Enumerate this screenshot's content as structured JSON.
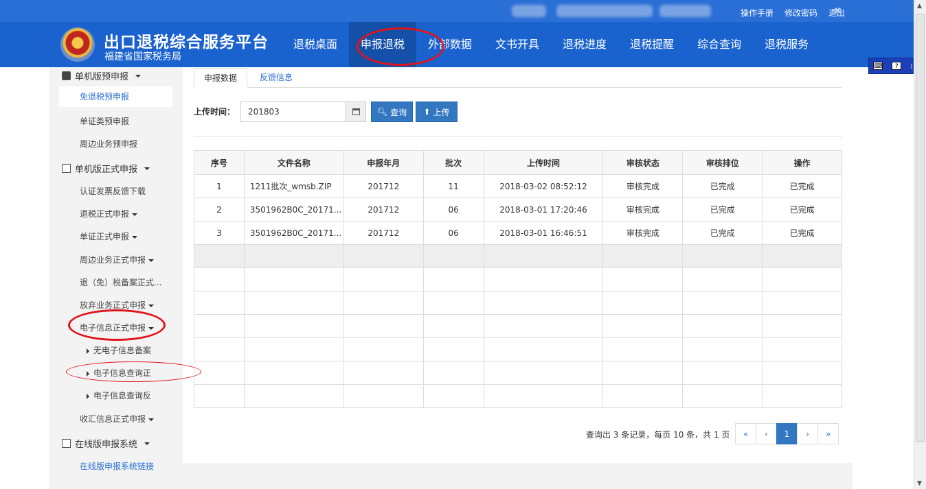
{
  "topbar": {
    "links": [
      "操作手册",
      "修改密码",
      "退出"
    ],
    "close_icon": "✖"
  },
  "header": {
    "title": "出口退税综合服务平台",
    "subtitle": "福建省国家税务局",
    "nav": [
      "退税桌面",
      "申报退税",
      "外部数据",
      "文书开具",
      "退税进度",
      "退税提醒",
      "综合查询",
      "退税服务"
    ],
    "active_nav": "申报退税"
  },
  "sidebar": {
    "group1": "单机版预申报",
    "g1_items": [
      "免退税预申报",
      "单证类预申报",
      "周边业务预申报"
    ],
    "group2": "单机版正式申报",
    "g2_items": [
      "认证发票反馈下载",
      "退税正式申报",
      "单证正式申报",
      "周边业务正式申报",
      "退（免）税备案正式...",
      "放弃业务正式申报",
      "电子信息正式申报"
    ],
    "g2_subitems": [
      "无电子信息备案",
      "电子信息查询正",
      "电子信息查询反"
    ],
    "g2_last": "收汇信息正式申报",
    "group3": "在线版申报系统",
    "g3_link": "在线版申报系统链接"
  },
  "tabs": [
    "申报数据",
    "反馈信息"
  ],
  "filter": {
    "label": "上传时间：",
    "value": "201803",
    "query_button": "查询",
    "upload_button": "上传"
  },
  "table": {
    "headers": [
      "序号",
      "文件名称",
      "申报年月",
      "批次",
      "上传时间",
      "审核状态",
      "审核排位",
      "操作"
    ],
    "rows": [
      [
        "1",
        "1211批次_wmsb.ZIP",
        "201712",
        "11",
        "2018-03-02 08:52:12",
        "审核完成",
        "已完成",
        "已完成"
      ],
      [
        "2",
        "3501962B0C_20171...",
        "201712",
        "06",
        "2018-03-01 17:20:46",
        "审核完成",
        "已完成",
        "已完成"
      ],
      [
        "3",
        "3501962B0C_20171...",
        "201712",
        "06",
        "2018-03-01 16:46:51",
        "审核完成",
        "已完成",
        "已完成"
      ]
    ]
  },
  "pager": {
    "summary": "查询出 3 条记录，每页 10 条，共 1 页",
    "first": "«",
    "prev": "‹",
    "current": "1",
    "next": "›",
    "last": "»"
  }
}
